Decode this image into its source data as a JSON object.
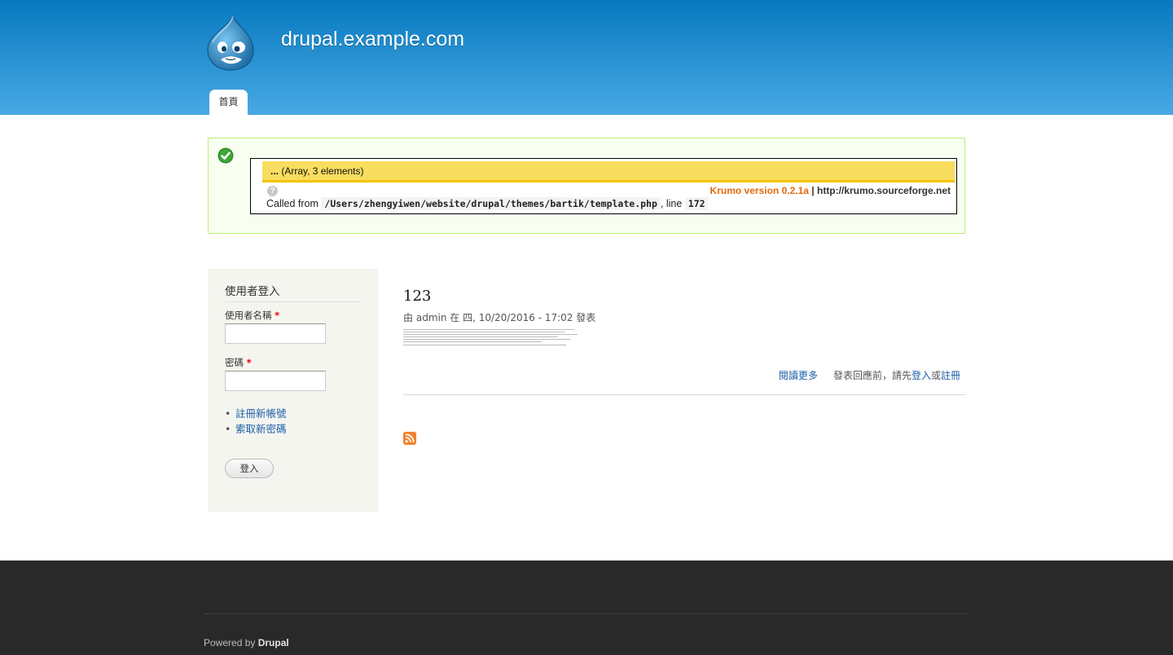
{
  "header": {
    "site_name": "drupal.example.com",
    "nav": {
      "home_tab": "首頁"
    }
  },
  "krumo": {
    "ellipsis": "...",
    "array_summary": "(Array, 3 elements)",
    "help_glyph": "?",
    "version_label": "Krumo version 0.2.1a",
    "separator": "|",
    "url": "http://krumo.sourceforge.net",
    "called_from_label": "Called from",
    "file_path": "/Users/zhengyiwen/website/drupal/themes/bartik/template.php",
    "line_label": ", line",
    "line_number": "172"
  },
  "login_block": {
    "title": "使用者登入",
    "username_label": "使用者名稱",
    "password_label": "密碼",
    "required_marker": "*",
    "links": [
      {
        "label": "註冊新帳號"
      },
      {
        "label": "索取新密碼"
      }
    ],
    "submit_label": "登入"
  },
  "node": {
    "title": "123",
    "meta_prefix": "由",
    "author": "admin",
    "meta_mid": "在 四, 10/20/2016 - 17:02 發表",
    "read_more": "閱讀更多",
    "comment_prefix": "發表回應前，請先",
    "login_link": "登入",
    "or": "或",
    "register_link": "註冊"
  },
  "footer": {
    "powered_by": "Powered by",
    "drupal": "Drupal"
  },
  "colors": {
    "header_top": "#0779bf",
    "header_bottom": "#48a9e4",
    "message_bg": "#f8fff0",
    "message_border": "#bbee77",
    "krumo_bar": "#f8dd5f",
    "krumo_version": "#e36a0a",
    "link": "#1a5fa8",
    "footer_bg": "#292929"
  },
  "icons": {
    "logo": "drupal-drop-logo",
    "status": "check-circle-icon",
    "feed": "rss-feed-icon"
  }
}
